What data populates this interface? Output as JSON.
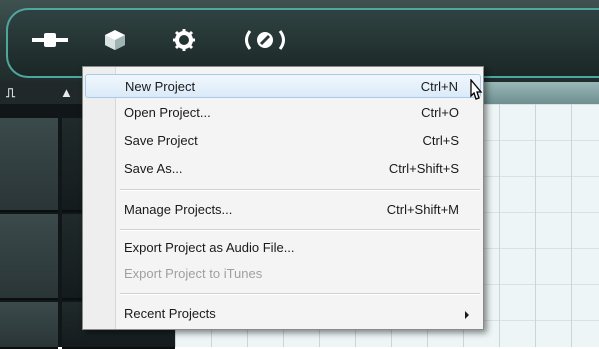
{
  "menu": {
    "items": [
      {
        "label": "New Project",
        "shortcut": "Ctrl+N"
      },
      {
        "label": "Open Project...",
        "shortcut": "Ctrl+O"
      },
      {
        "label": "Save Project",
        "shortcut": "Ctrl+S"
      },
      {
        "label": "Save As...",
        "shortcut": "Ctrl+Shift+S"
      },
      {
        "label": "Manage Projects...",
        "shortcut": "Ctrl+Shift+M"
      },
      {
        "label": "Export Project as Audio File...",
        "shortcut": ""
      },
      {
        "label": "Export Project to iTunes",
        "shortcut": "",
        "disabled": true
      },
      {
        "label": "Recent Projects",
        "shortcut": "",
        "submenu": true
      }
    ]
  },
  "toolbar": {
    "icons": [
      "plug-icon",
      "package-icon",
      "gear-icon",
      "dial-icon"
    ]
  },
  "colors": {
    "toolbar_bg": "#2a3a39",
    "toolbar_accent": "#4ea79f",
    "menu_highlight": "#dbeaf8"
  }
}
